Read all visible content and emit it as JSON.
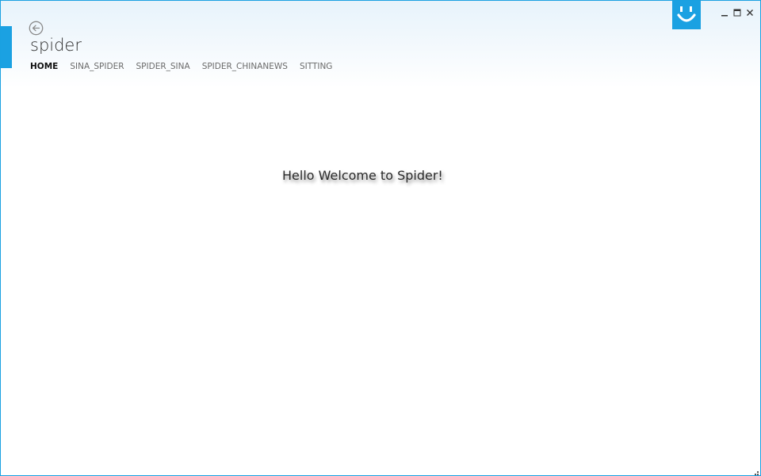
{
  "app": {
    "title": "spider"
  },
  "tabs": [
    {
      "label": "HOME",
      "active": true
    },
    {
      "label": "SINA_SPIDER",
      "active": false
    },
    {
      "label": "SPIDER_SINA",
      "active": false
    },
    {
      "label": "SPIDER_CHINANEWS",
      "active": false
    },
    {
      "label": "SITTING",
      "active": false
    }
  ],
  "main": {
    "welcome_text": "Hello Welcome to Spider!"
  },
  "icons": {
    "back": "back-arrow-icon",
    "logo": "smiley-logo-icon",
    "minimize": "minimize-icon",
    "maximize": "maximize-icon",
    "close": "close-icon",
    "resize": "resize-grip-icon"
  },
  "colors": {
    "accent": "#1ba1e2",
    "window_border": "#1aa1e1",
    "text_primary": "#2c2c2c",
    "tab_inactive": "#6b6b6b"
  }
}
